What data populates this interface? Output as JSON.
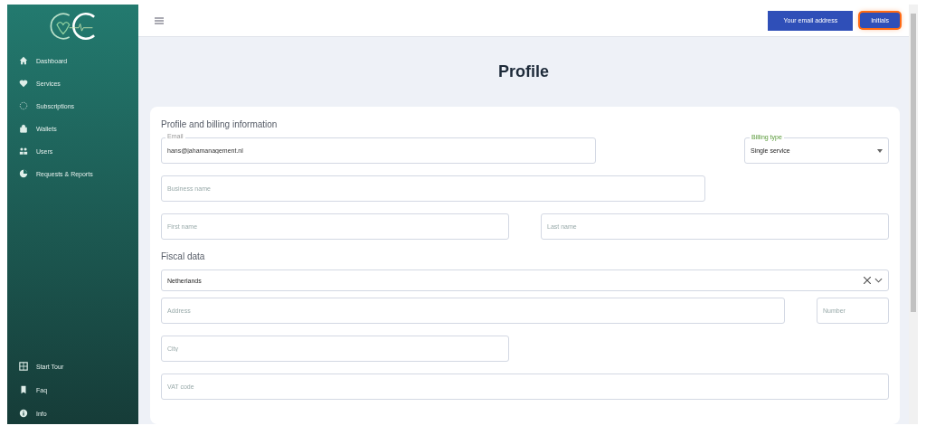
{
  "sidebar": {
    "items": [
      {
        "label": "Dashboard"
      },
      {
        "label": "Services"
      },
      {
        "label": "Subscriptions"
      },
      {
        "label": "Wallets"
      },
      {
        "label": "Users"
      },
      {
        "label": "Requests & Reports"
      }
    ],
    "footer_items": [
      {
        "label": "Start Tour"
      },
      {
        "label": "Faq"
      },
      {
        "label": "Info"
      }
    ]
  },
  "topbar": {
    "email_button": "Your email address",
    "initials_button": "Initials"
  },
  "page_title": "Profile",
  "sections": [
    {
      "title": "Profile and billing information",
      "rows": [
        [
          {
            "kind": "text",
            "label": "Email",
            "value": "hans@jahamanagement.nl"
          },
          {
            "kind": "select",
            "label": "Billing type",
            "value": "Single service"
          }
        ],
        [
          {
            "kind": "text",
            "placeholder": "Business name"
          }
        ],
        [
          {
            "kind": "text",
            "placeholder": "First name"
          },
          {
            "kind": "text",
            "placeholder": "Last name"
          }
        ]
      ]
    },
    {
      "title": "Fiscal data",
      "rows": [
        [
          {
            "kind": "combo",
            "value": "Netherlands"
          }
        ],
        [
          {
            "kind": "text",
            "placeholder": "Address"
          },
          {
            "kind": "text",
            "placeholder": "Number"
          }
        ],
        [
          {
            "kind": "text",
            "placeholder": "City"
          }
        ],
        [
          {
            "kind": "text",
            "placeholder": "VAT code"
          }
        ]
      ]
    }
  ]
}
